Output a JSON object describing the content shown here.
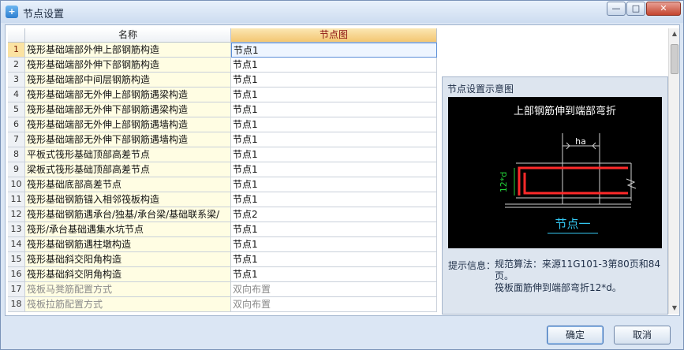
{
  "window": {
    "title": "节点设置",
    "app_icon": "app-icon",
    "minimize": "—",
    "maximize": "□",
    "close": "✕"
  },
  "grid": {
    "columns": [
      "名称",
      "节点图"
    ],
    "rows": [
      {
        "num": "1",
        "name": "筏形基础端部外伸上部钢筋构造",
        "node": "节点1",
        "selected": true,
        "disabled": false
      },
      {
        "num": "2",
        "name": "筏形基础端部外伸下部钢筋构造",
        "node": "节点1",
        "selected": false,
        "disabled": false
      },
      {
        "num": "3",
        "name": "筏形基础端部中间层钢筋构造",
        "node": "节点1",
        "selected": false,
        "disabled": false
      },
      {
        "num": "4",
        "name": "筏形基础端部无外伸上部钢筋遇梁构造",
        "node": "节点1",
        "selected": false,
        "disabled": false
      },
      {
        "num": "5",
        "name": "筏形基础端部无外伸下部钢筋遇梁构造",
        "node": "节点1",
        "selected": false,
        "disabled": false
      },
      {
        "num": "6",
        "name": "筏形基础端部无外伸上部钢筋遇墙构造",
        "node": "节点1",
        "selected": false,
        "disabled": false
      },
      {
        "num": "7",
        "name": "筏形基础端部无外伸下部钢筋遇墙构造",
        "node": "节点1",
        "selected": false,
        "disabled": false
      },
      {
        "num": "8",
        "name": "平板式筏形基础顶部高差节点",
        "node": "节点1",
        "selected": false,
        "disabled": false
      },
      {
        "num": "9",
        "name": "梁板式筏形基础顶部高差节点",
        "node": "节点1",
        "selected": false,
        "disabled": false
      },
      {
        "num": "10",
        "name": "筏形基础底部高差节点",
        "node": "节点1",
        "selected": false,
        "disabled": false
      },
      {
        "num": "11",
        "name": "筏形基础钢筋锚入相邻筏板构造",
        "node": "节点1",
        "selected": false,
        "disabled": false
      },
      {
        "num": "12",
        "name": "筏形基础钢筋遇承台/独基/承台梁/基础联系梁/",
        "node": "节点2",
        "selected": false,
        "disabled": false
      },
      {
        "num": "13",
        "name": "筏形/承台基础遇集水坑节点",
        "node": "节点1",
        "selected": false,
        "disabled": false
      },
      {
        "num": "14",
        "name": "筏形基础钢筋遇柱墩构造",
        "node": "节点1",
        "selected": false,
        "disabled": false
      },
      {
        "num": "15",
        "name": "筏形基础斜交阳角构造",
        "node": "节点1",
        "selected": false,
        "disabled": false
      },
      {
        "num": "16",
        "name": "筏形基础斜交阴角构造",
        "node": "节点1",
        "selected": false,
        "disabled": false
      },
      {
        "num": "17",
        "name": "筏板马凳筋配置方式",
        "node": "双向布置",
        "selected": false,
        "disabled": true
      },
      {
        "num": "18",
        "name": "筏板拉筋配置方式",
        "node": "双向布置",
        "selected": false,
        "disabled": true
      }
    ]
  },
  "preview": {
    "title": "节点设置示意图",
    "diagram_title": "上部钢筋伸到端部弯折",
    "dim_ha": "ha",
    "dim_12d": "12*d",
    "node_label": "节点一",
    "hint_label": "提示信息：",
    "hint_line1": "规范算法：来源11G101-3第80页和84页。",
    "hint_line2": "筏板面筋伸到端部弯折12*d。"
  },
  "footer": {
    "ok": "确定",
    "cancel": "取消"
  }
}
